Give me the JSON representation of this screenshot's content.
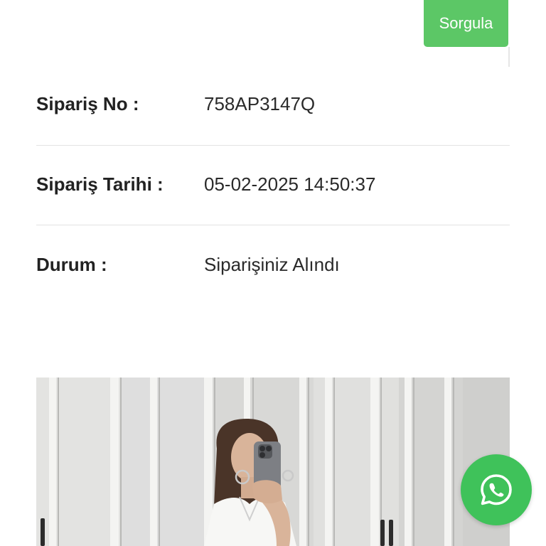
{
  "query": {
    "button_label": "Sorgula",
    "button_color": "#5cc766"
  },
  "order": {
    "rows": [
      {
        "label": "Sipariş No :",
        "value": "758AP3147Q"
      },
      {
        "label": "Sipariş Tarihi :",
        "value": "05-02-2025 14:50:37"
      },
      {
        "label": "Durum :",
        "value": "Siparişiniz Alındı"
      }
    ]
  },
  "product_image": {
    "subject": "mirror-selfie-photo"
  },
  "whatsapp": {
    "icon": "whatsapp-icon",
    "color": "#3fc25a"
  }
}
